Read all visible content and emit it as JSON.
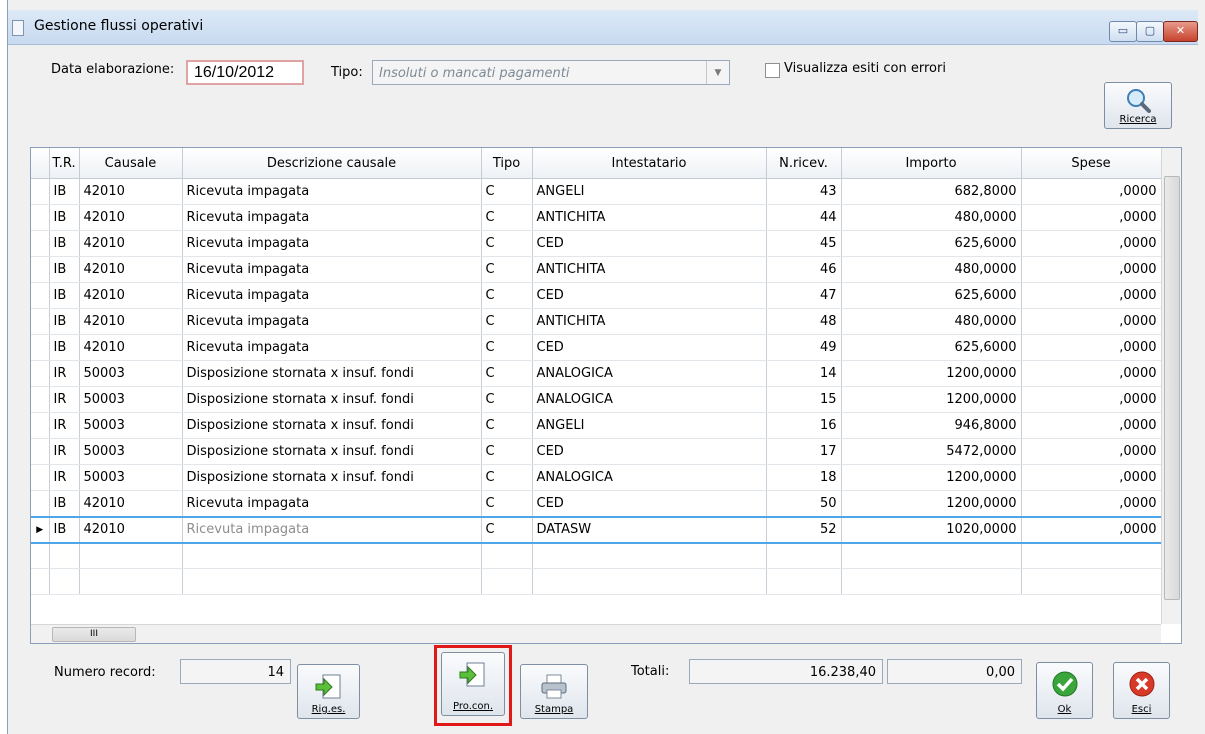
{
  "window": {
    "title": "Gestione flussi operativi",
    "minimize_glyph": "▭",
    "maximize_glyph": "▢",
    "close_glyph": "✕"
  },
  "filters": {
    "date_label": "Data elaborazione:",
    "date_value": "16/10/2012",
    "tipo_label": "Tipo:",
    "tipo_value": "Insoluti o mancati pagamenti",
    "errors_checkbox_label": "Visualizza esiti con errori"
  },
  "buttons": {
    "search": "Ricerca",
    "rig_es": "Rig.es.",
    "pro_con": "Pro.con.",
    "print": "Stampa",
    "ok": "Ok",
    "exit": "Esci"
  },
  "grid": {
    "columns": [
      "T.R.",
      "Causale",
      "Descrizione causale",
      "Tipo",
      "Intestatario",
      "N.ricev.",
      "Importo",
      "Spese"
    ],
    "rows": [
      [
        "IB",
        "42010",
        "Ricevuta impagata",
        "C",
        "ANGELI",
        "43",
        "682,8000",
        ",0000"
      ],
      [
        "IB",
        "42010",
        "Ricevuta impagata",
        "C",
        "ANTICHITA",
        "44",
        "480,0000",
        ",0000"
      ],
      [
        "IB",
        "42010",
        "Ricevuta impagata",
        "C",
        "CED",
        "45",
        "625,6000",
        ",0000"
      ],
      [
        "IB",
        "42010",
        "Ricevuta impagata",
        "C",
        "ANTICHITA",
        "46",
        "480,0000",
        ",0000"
      ],
      [
        "IB",
        "42010",
        "Ricevuta impagata",
        "C",
        "CED",
        "47",
        "625,6000",
        ",0000"
      ],
      [
        "IB",
        "42010",
        "Ricevuta impagata",
        "C",
        "ANTICHITA",
        "48",
        "480,0000",
        ",0000"
      ],
      [
        "IB",
        "42010",
        "Ricevuta impagata",
        "C",
        "CED",
        "49",
        "625,6000",
        ",0000"
      ],
      [
        "IR",
        "50003",
        "Disposizione stornata x insuf. fondi",
        "C",
        "ANALOGICA",
        "14",
        "1200,0000",
        ",0000"
      ],
      [
        "IR",
        "50003",
        "Disposizione stornata x insuf. fondi",
        "C",
        "ANALOGICA",
        "15",
        "1200,0000",
        ",0000"
      ],
      [
        "IR",
        "50003",
        "Disposizione stornata x insuf. fondi",
        "C",
        "ANGELI",
        "16",
        "946,8000",
        ",0000"
      ],
      [
        "IR",
        "50003",
        "Disposizione stornata x insuf. fondi",
        "C",
        "CED",
        "17",
        "5472,0000",
        ",0000"
      ],
      [
        "IR",
        "50003",
        "Disposizione stornata x insuf. fondi",
        "C",
        "ANALOGICA",
        "18",
        "1200,0000",
        ",0000"
      ],
      [
        "IB",
        "42010",
        "Ricevuta impagata",
        "C",
        "CED",
        "50",
        "1200,0000",
        ",0000"
      ],
      [
        "IB",
        "42010",
        "Ricevuta impagata",
        "C",
        "DATASW",
        "52",
        "1020,0000",
        ",0000"
      ]
    ],
    "selected_row": 13,
    "hscroll_thumb": "III"
  },
  "footer": {
    "record_label": "Numero record:",
    "record_count": "14",
    "totals_label": "Totali:",
    "total_importo": "16.238,40",
    "total_spese": "0,00"
  },
  "colors": {
    "highlight_box": "#e01818",
    "selection": "#4ea5e8",
    "ok_green": "#3aa53a",
    "exit_red": "#d83a2a"
  }
}
